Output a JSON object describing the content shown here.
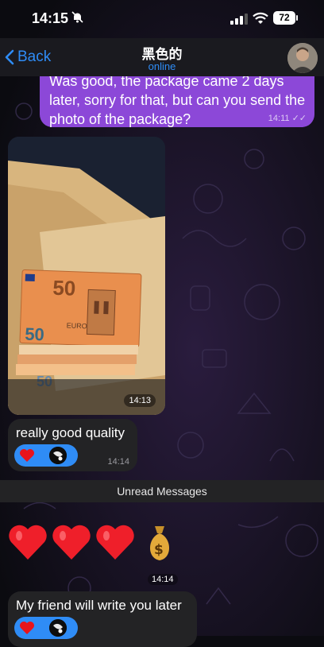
{
  "status_bar": {
    "time": "14:15",
    "battery": "72"
  },
  "header": {
    "back_label": "Back",
    "title": "黑色的",
    "status": "online"
  },
  "messages": [
    {
      "type": "outgoing_text",
      "text": "Was good, the package came 2 days later, sorry for that, but can you send the photo of the package?",
      "time": "14:11"
    },
    {
      "type": "incoming_photo",
      "time": "14:13"
    },
    {
      "type": "incoming_text",
      "text": "really good quality",
      "time": "14:14"
    },
    {
      "type": "divider",
      "text": "Unread Messages"
    },
    {
      "type": "incoming_emoji",
      "time": "14:14"
    },
    {
      "type": "incoming_text",
      "text": "My friend will write you later"
    }
  ],
  "colors": {
    "accent": "#2f8cf6",
    "outgoing_bubble": "#8c48d8",
    "incoming_bubble": "#232325"
  }
}
